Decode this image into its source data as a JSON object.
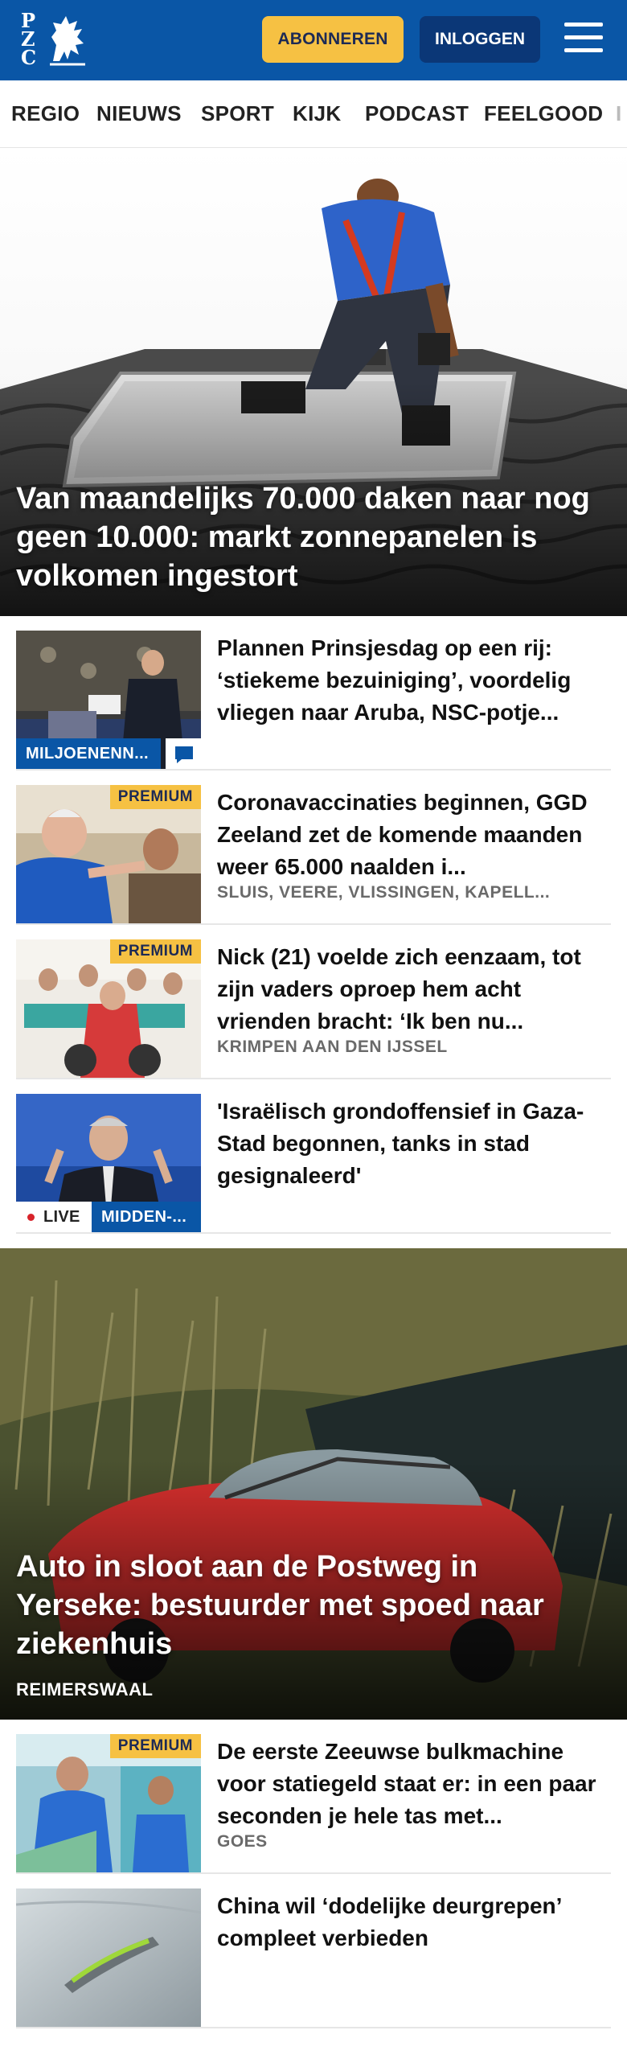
{
  "header": {
    "logo_text": "PZC",
    "subscribe_label": "ABONNEREN",
    "login_label": "INLOGGEN",
    "menu_icon": "hamburger-icon",
    "colors": {
      "brand": "#0a56a6",
      "accent": "#f6c143",
      "login_bg": "#0b3777"
    }
  },
  "nav": {
    "items": [
      "REGIO",
      "NIEUWS",
      "SPORT",
      "KIJK",
      "PODCAST",
      "FEELGOOD",
      "I"
    ]
  },
  "hero1": {
    "title": "Van maandelijks 70.000 daken naar nog geen 10.000: markt zonnepanelen is volkomen ingestort"
  },
  "articles_1": [
    {
      "title": "Plannen Prinsjesdag op een rij: ‘stiekeme bezuiniging’, voordelig vliegen naar Aruba, NSC-potje...",
      "tag": "MILJOENENN...",
      "comment_icon": "comment-icon"
    },
    {
      "badge": "PREMIUM",
      "title": "Coronavaccinaties beginnen, GGD Zeeland zet de komende maanden weer 65.000 naalden i...",
      "location": "SLUIS, VEERE, VLISSINGEN, KAPELL..."
    },
    {
      "badge": "PREMIUM",
      "title": "Nick (21) voelde zich eenzaam, tot zijn vaders oproep hem acht vrienden bracht: ‘Ik ben nu...",
      "location": "KRIMPEN AAN DEN IJSSEL"
    },
    {
      "title": "'Israëlisch grondoffensief in Gaza-Stad begonnen, tanks in stad gesignaleerd'",
      "live_label": "LIVE",
      "tag": "MIDDEN-..."
    }
  ],
  "hero2": {
    "title": "Auto in sloot aan de Postweg in Yerseke: bestuurder met spoed naar ziekenhuis",
    "location": "REIMERSWAAL"
  },
  "articles_2": [
    {
      "badge": "PREMIUM",
      "title": "De eerste Zeeuwse bulkmachine voor statiegeld staat er: in een paar seconden je hele tas met...",
      "location": "GOES"
    },
    {
      "title": "China wil ‘dodelijke deurgrepen’ compleet verbieden"
    }
  ]
}
